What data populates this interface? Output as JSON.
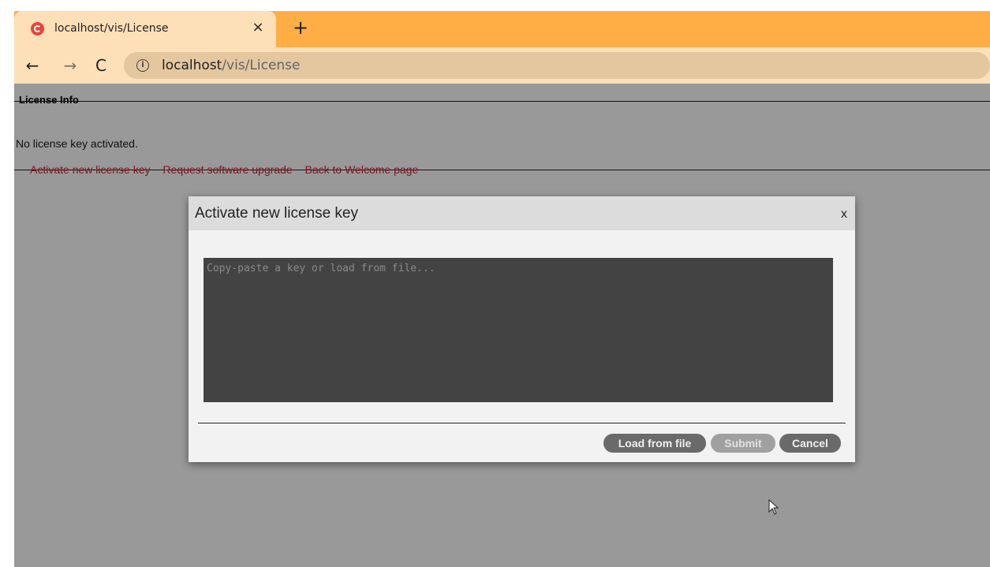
{
  "browser": {
    "tab_title": "localhost/vis/License",
    "tab_close": "×",
    "new_tab": "+",
    "nav_back": "←",
    "nav_forward": "→",
    "nav_reload": "C",
    "url_host": "localhost",
    "url_path": "/vis/License"
  },
  "page": {
    "section_title": "License Info",
    "status": "No license key activated.",
    "links": [
      "Activate new license key",
      "Request software upgrade",
      "Back to Welcome page"
    ]
  },
  "modal": {
    "title": "Activate new license key",
    "close": "x",
    "textarea_placeholder": "Copy-paste a key or load from file...",
    "buttons": {
      "load": "Load from file",
      "submit": "Submit",
      "cancel": "Cancel"
    }
  },
  "colors": {
    "tabstrip": "#ffad45",
    "toolbar": "#fde0b7",
    "link": "#d6223d",
    "textarea_bg": "#434343"
  }
}
